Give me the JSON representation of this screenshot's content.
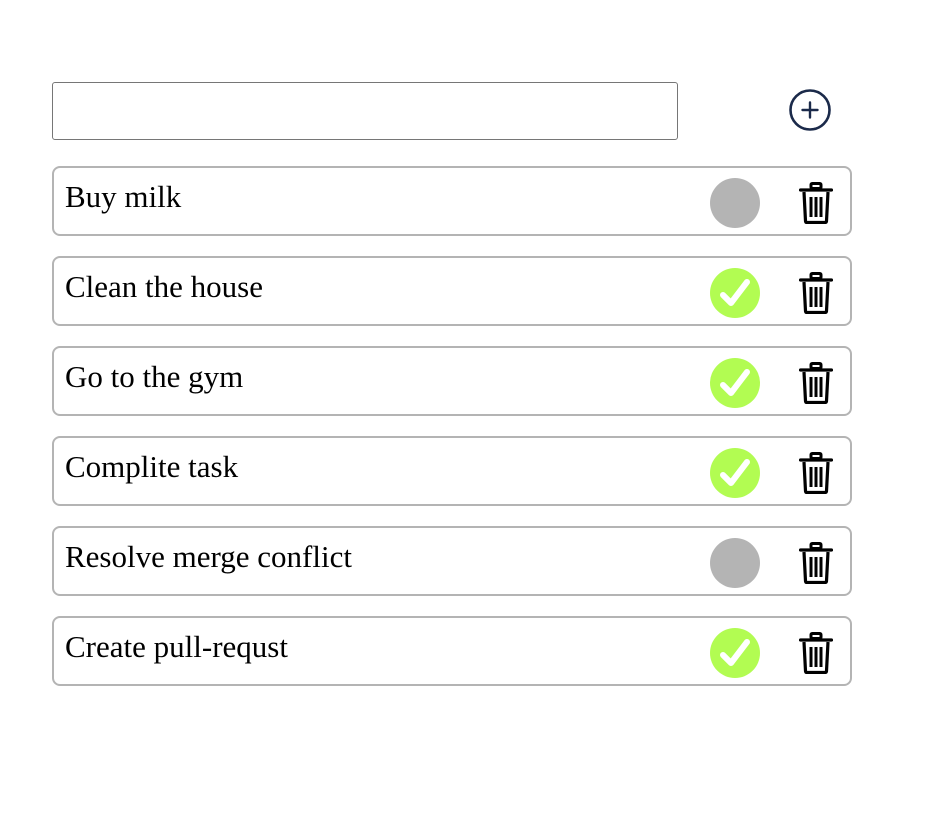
{
  "new_task": {
    "value": "",
    "placeholder": ""
  },
  "icons": {
    "add": "plus-circle-icon",
    "done": "check-mark-icon",
    "delete": "trash-icon"
  },
  "colors": {
    "done": "#b2fc52",
    "pending": "#b4b4b4",
    "add_icon": "#1b2a4a",
    "border": "#b4b4b4"
  },
  "tasks": [
    {
      "text": "Buy milk",
      "done": false
    },
    {
      "text": "Clean the house",
      "done": true
    },
    {
      "text": "Go to the gym",
      "done": true
    },
    {
      "text": "Complite task",
      "done": true
    },
    {
      "text": "Resolve merge conflict",
      "done": false
    },
    {
      "text": "Create pull-requst",
      "done": true
    }
  ]
}
